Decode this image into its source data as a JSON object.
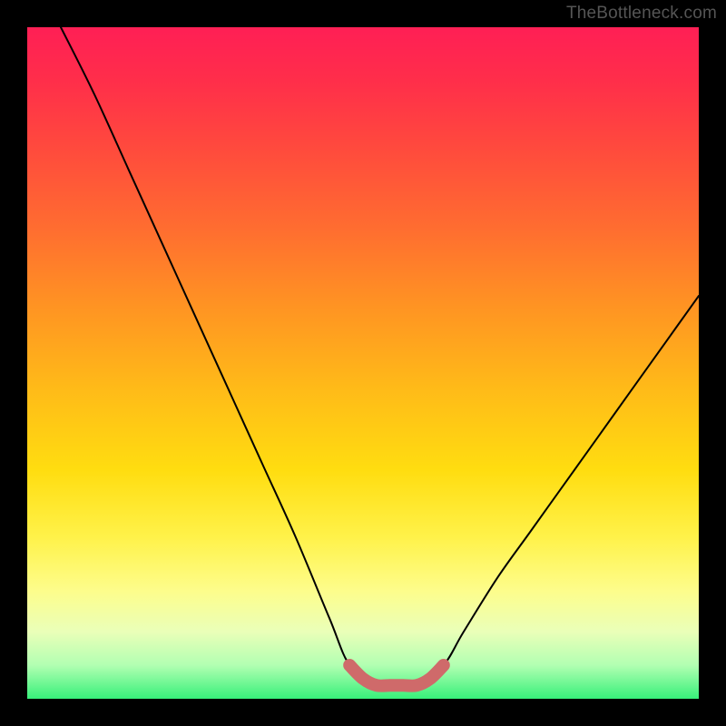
{
  "watermark": "TheBottleneck.com",
  "chart_data": {
    "type": "line",
    "title": "",
    "xlabel": "",
    "ylabel": "",
    "xlim": [
      0,
      100
    ],
    "ylim": [
      0,
      100
    ],
    "series": [
      {
        "name": "bottleneck-curve",
        "x": [
          5,
          10,
          15,
          20,
          25,
          30,
          35,
          40,
          45,
          48,
          52,
          55,
          58,
          62,
          65,
          70,
          75,
          80,
          85,
          90,
          95,
          100
        ],
        "y": [
          100,
          90,
          79,
          68,
          57,
          46,
          35,
          24,
          12,
          5,
          2,
          2,
          2,
          5,
          10,
          18,
          25,
          32,
          39,
          46,
          53,
          60
        ]
      },
      {
        "name": "optimal-region",
        "x": [
          48,
          50,
          52,
          54,
          56,
          58,
          60,
          62
        ],
        "y": [
          5,
          3,
          2,
          2,
          2,
          2,
          3,
          5
        ]
      }
    ],
    "annotations": []
  }
}
